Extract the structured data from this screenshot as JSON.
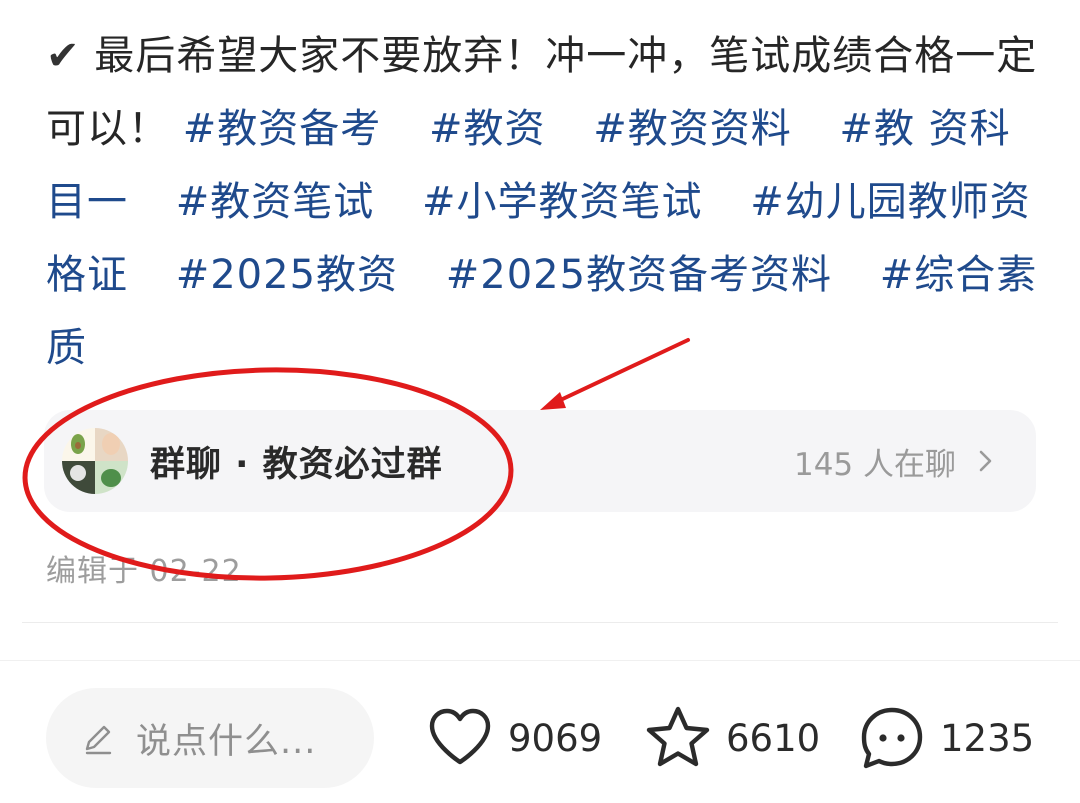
{
  "post": {
    "check_mark": "✔",
    "body_text": "最后希望大家不要放弃！冲一冲，笔试成绩合格一定可以！",
    "tags": [
      "#教资备考",
      "#教资",
      "#教资资料",
      "#教 资科目一",
      "#教资笔试",
      "#小学教资笔试",
      "#幼儿园教师资格证",
      "#2025教资",
      "#2025教资备考资料",
      "#综合素质"
    ]
  },
  "group_chat": {
    "name": "群聊 · 教资必过群",
    "member_status": "145 人在聊",
    "icon": "chevron-right-icon"
  },
  "edit_time": "编辑于 02-22",
  "bottom_bar": {
    "comment_placeholder": "说点什么...",
    "likes": "9069",
    "collects": "6610",
    "comments": "1235"
  },
  "colors": {
    "tag": "#1f4a8c",
    "annotation_red": "#e01b1b",
    "card_bg": "#f5f5f7"
  }
}
